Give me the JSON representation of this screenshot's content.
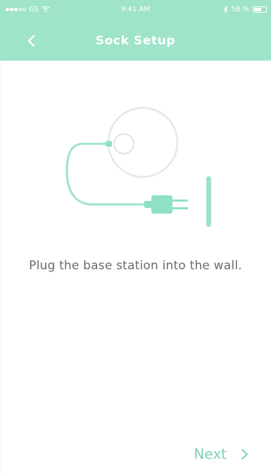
{
  "status_bar": {
    "carrier": "GS",
    "time": "9:41 AM",
    "battery": "58 %",
    "signal_bars_filled": 3,
    "signal_bars_total": 5
  },
  "nav": {
    "title": "Sock Setup",
    "back_icon": "chevron-left-icon"
  },
  "illustration": {
    "icon": "base-station-plug-illustration"
  },
  "main": {
    "instruction": "Plug the base station into the wall."
  },
  "footer": {
    "next_label": "Next",
    "next_icon": "chevron-right-icon"
  },
  "colors": {
    "accent": "#9fe3c9",
    "accent_dark": "#7cd4b6",
    "text": "#6a6a6a"
  }
}
